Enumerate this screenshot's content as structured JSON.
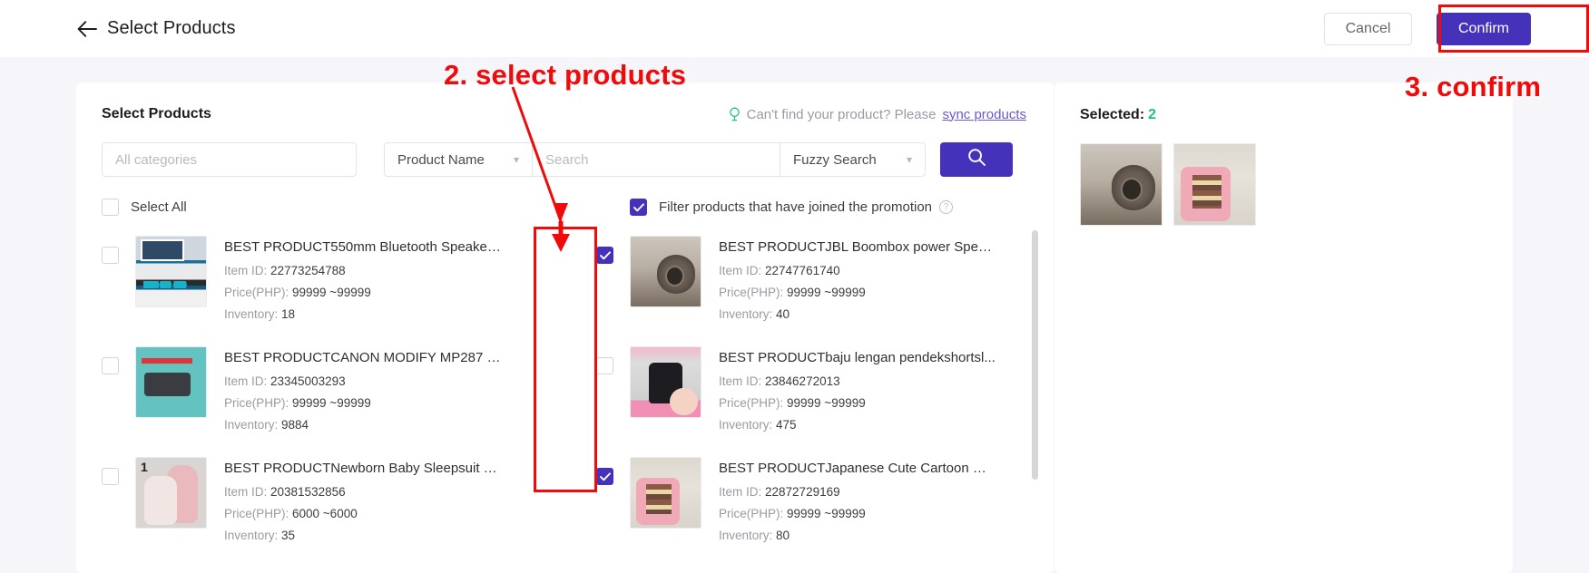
{
  "topbar": {
    "back_icon": "arrow-left-icon",
    "title": "Select Products",
    "cancel_label": "Cancel",
    "confirm_label": "Confirm"
  },
  "colors": {
    "brand_purple": "#4432ba",
    "accent_green": "#19c37d",
    "annotation_red": "#f00a0a",
    "link_purple": "#6c57d6"
  },
  "left_panel": {
    "title": "Select Products",
    "hint_icon": "lightbulb-icon",
    "hint_text": "Can't find your product? Please",
    "hint_link": "sync products",
    "category_placeholder": "All categories",
    "search_field_label": "Product Name",
    "search_placeholder": "Search",
    "search_value": "",
    "match_mode_label": "Fuzzy Search",
    "search_button_icon": "search-icon",
    "select_all_label": "Select All",
    "select_all_checked": false,
    "filter_promo_label": "Filter products that have joined the promotion",
    "filter_promo_checked": true,
    "filter_promo_help_icon": "question-circle-icon",
    "meta_labels": {
      "item_id": "Item ID:",
      "price": "Price(PHP):",
      "inventory": "Inventory:"
    },
    "products": [
      {
        "name": "BEST PRODUCT550mm Bluetooth Speaker ...",
        "item_id": "22773254788",
        "price": "99999 ~99999",
        "inventory": "18",
        "checked": false,
        "art": "art-speaker",
        "badge": ""
      },
      {
        "name": "BEST PRODUCTJBL Boombox power Speak...",
        "item_id": "22747761740",
        "price": "99999 ~99999",
        "inventory": "40",
        "checked": true,
        "art": "art-jbl",
        "badge": ""
      },
      {
        "name": "BEST PRODUCTCANON MODIFY MP287 W...",
        "item_id": "23345003293",
        "price": "99999 ~99999",
        "inventory": "9884",
        "checked": false,
        "art": "art-printer",
        "badge": ""
      },
      {
        "name": "BEST PRODUCTbaju lengan pendekshortsl...",
        "item_id": "23846272013",
        "price": "99999 ~99999",
        "inventory": "475",
        "checked": false,
        "art": "art-tshirt",
        "badge": ""
      },
      {
        "name": "BEST PRODUCTNewborn Baby Sleepsuit Ca...",
        "item_id": "20381532856",
        "price": "6000 ~6000",
        "inventory": "35",
        "checked": false,
        "art": "art-baby",
        "badge": "1"
      },
      {
        "name": "BEST PRODUCTJapanese Cute Cartoon Cra...",
        "item_id": "22872729169",
        "price": "99999 ~99999",
        "inventory": "80",
        "checked": true,
        "art": "art-cartoon",
        "badge": ""
      }
    ]
  },
  "right_panel": {
    "selected_label": "Selected:",
    "selected_count": "2",
    "thumbs": [
      {
        "art": "art-jbl"
      },
      {
        "art": "art-cartoon"
      }
    ]
  },
  "annotations": [
    {
      "id": "step2",
      "text": "2. select products"
    },
    {
      "id": "step3",
      "text": "3. confirm"
    }
  ]
}
